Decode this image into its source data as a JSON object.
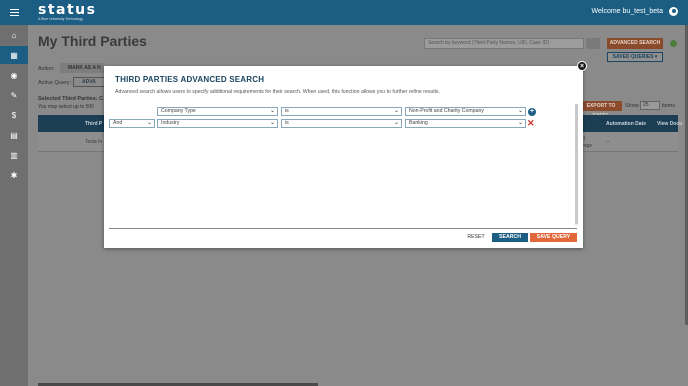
{
  "header": {
    "logo": "status",
    "logo_sub": "A Blue University Technology",
    "welcome": "Welcome bu_test_beta"
  },
  "sidebar": {
    "items": [
      {
        "name": "home",
        "glyph": "⌂"
      },
      {
        "name": "third-parties",
        "glyph": "▦",
        "active": true
      },
      {
        "name": "monitor",
        "glyph": "◉"
      },
      {
        "name": "assessments",
        "glyph": "✎"
      },
      {
        "name": "finance",
        "glyph": "$"
      },
      {
        "name": "documents",
        "glyph": "▤"
      },
      {
        "name": "reports",
        "glyph": "▥"
      },
      {
        "name": "settings",
        "glyph": "✱"
      }
    ]
  },
  "page": {
    "title": "My Third Parties",
    "search_placeholder": "Search by keyword (Third Party Names, UID, Case ID)",
    "advanced_search": "ADVANCED SEARCH",
    "saved_queries": "SAVED QUERIES ▾",
    "action_label": "Action:",
    "mark_as": "MARK AS A N",
    "active_query_label": "Active Query:",
    "active_query_chip": "ADVA",
    "selected_third": "Selected Third Parties: C",
    "select_up": "You may select up to 500",
    "export": "EXPORT TO EXCEL",
    "show": "Show",
    "show_value": "25",
    "items": "items",
    "columns": {
      "third": "Third P",
      "automation_date": "Automation Date",
      "view_docs": "View Docu"
    },
    "row": {
      "name": "Tesla In",
      "col_a": "d",
      "col_b": "orge",
      "col_c": "--"
    }
  },
  "modal": {
    "title": "THIRD PARTIES ADVANCED SEARCH",
    "description": "Advanced search allows users to specify additional requirements for their search. When used, this function allows you to further refine results.",
    "rows": [
      {
        "connector": "",
        "field": "Company Type",
        "operator": "is",
        "value": "Non-Profit and Charity Company"
      },
      {
        "connector": "And",
        "field": "Industry",
        "operator": "is",
        "value": "Banking"
      }
    ],
    "reset": "RESET",
    "search": "SEARCH",
    "save_query": "SAVE QUERY"
  },
  "colors": {
    "brand_blue": "#1c5e83",
    "accent_orange": "#e0683a",
    "delete_red": "#d1302a"
  }
}
